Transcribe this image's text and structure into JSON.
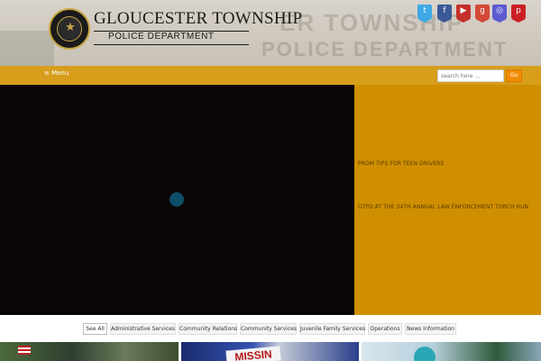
{
  "header": {
    "title": "GLOUCESTER TOWNSHIP",
    "subtitle": "POLICE DEPARTMENT",
    "background_sign_line1": "ER TOWNSHIP",
    "background_sign_line2": "POLICE DEPARTMENT",
    "social": [
      {
        "icon": "twitter-icon",
        "glyph": "t",
        "color": "#3fa9e5"
      },
      {
        "icon": "facebook-icon",
        "glyph": "f",
        "color": "#3b5998"
      },
      {
        "icon": "youtube-icon",
        "glyph": "▶",
        "color": "#c4302b"
      },
      {
        "icon": "google-plus-icon",
        "glyph": "g",
        "color": "#d34836"
      },
      {
        "icon": "instagram-icon",
        "glyph": "◎",
        "color": "#5c5ad0"
      },
      {
        "icon": "pinterest-icon",
        "glyph": "p",
        "color": "#cb2027"
      }
    ]
  },
  "nav": {
    "menu_label": "≡ Menu",
    "search_placeholder": "search here ...",
    "go_label": "Go"
  },
  "news": [
    "PROM TIPS FOR TEEN DRIVERS",
    "GTPD AT THE 34TH ANNUAL LAW ENFORCEMENT TORCH RUN"
  ],
  "filters": [
    "See All",
    "Administrative Services",
    "Community Relations",
    "Community Services",
    "Juvenile Family Services",
    "Operations",
    "News Information"
  ],
  "thumbnail_text": {
    "missing": "MISSIN"
  },
  "colors": {
    "nav": "#d79d1b",
    "news_panel": "#cf8f00",
    "go_button": "#f28c00"
  }
}
